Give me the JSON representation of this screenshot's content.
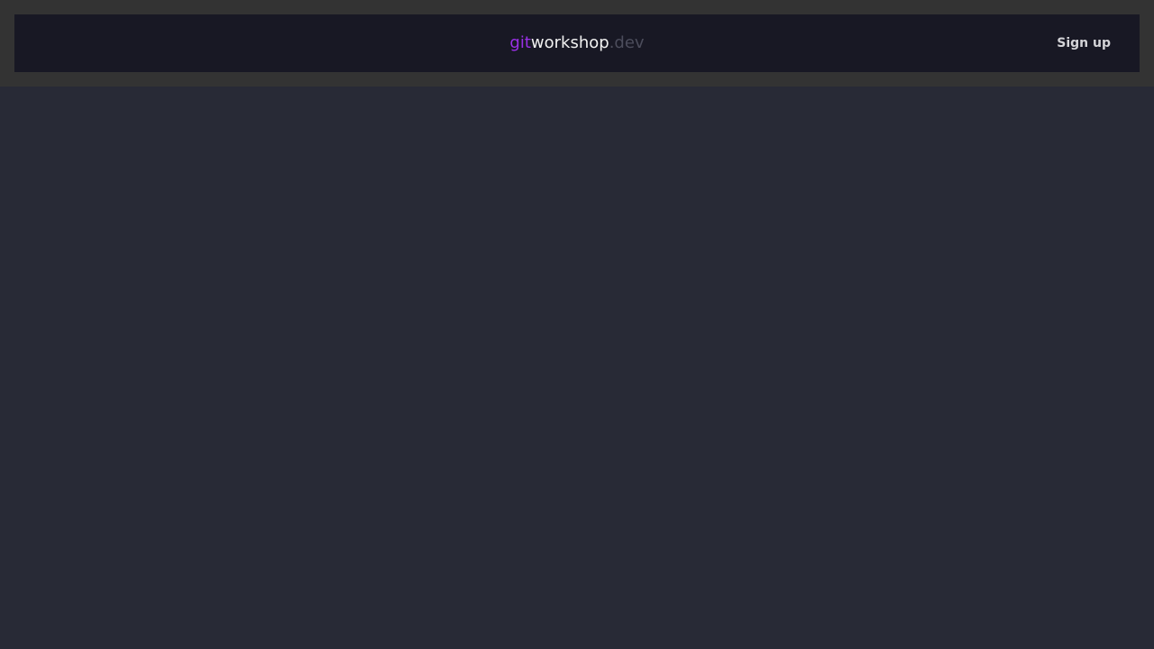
{
  "header": {
    "logo": {
      "part_git": "git",
      "part_workshop": "workshop",
      "part_tld": ".dev"
    },
    "signup_label": "Sign up"
  },
  "colors": {
    "page_background": "#282a36",
    "header_band": "#333333",
    "navbar": "#181824",
    "logo_accent": "#9b30e8",
    "logo_main": "#f2f2f2",
    "logo_muted": "#4c4d5c",
    "signup_text": "#d4d4d8"
  }
}
